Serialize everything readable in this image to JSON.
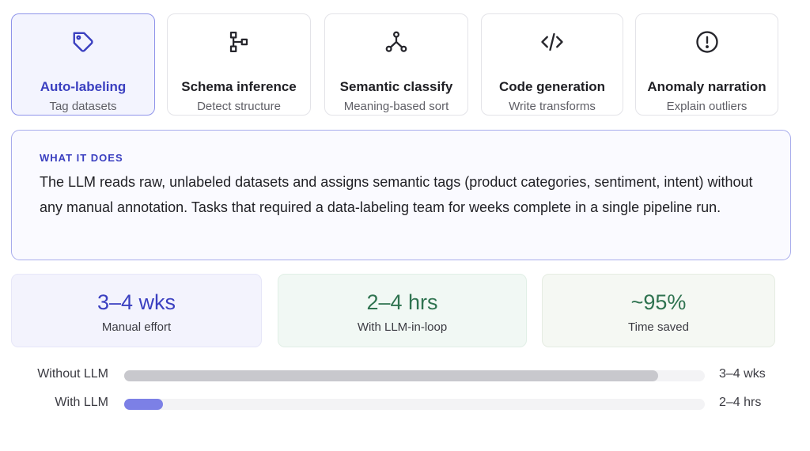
{
  "cards": [
    {
      "icon": "tag-icon",
      "title": "Auto-labeling",
      "subtitle": "Tag datasets",
      "active": true
    },
    {
      "icon": "hierarchy-icon",
      "title": "Schema inference",
      "subtitle": "Detect structure",
      "active": false
    },
    {
      "icon": "branch-icon",
      "title": "Semantic classify",
      "subtitle": "Meaning-based sort",
      "active": false
    },
    {
      "icon": "code-icon",
      "title": "Code generation",
      "subtitle": "Write transforms",
      "active": false
    },
    {
      "icon": "alert-circle-icon",
      "title": "Anomaly narration",
      "subtitle": "Explain outliers",
      "active": false
    }
  ],
  "what_it_does": {
    "label": "WHAT IT DOES",
    "description": "The LLM reads raw, unlabeled datasets and assigns semantic tags (product categories, sentiment, intent) without any manual annotation. Tasks that required a data-labeling team for weeks complete in a single pipeline run."
  },
  "metrics": [
    {
      "value": "3–4 wks",
      "label": "Manual effort",
      "color": "#3a3fc0",
      "bg": "#f3f3fd",
      "border": "#e6e6f8"
    },
    {
      "value": "2–4 hrs",
      "label": "With LLM-in-loop",
      "color": "#2f7350",
      "bg": "#f1f8f4",
      "border": "#e1efe6"
    },
    {
      "value": "~95%",
      "label": "Time saved",
      "color": "#2f7350",
      "bg": "#f5f8f3",
      "border": "#e5ece2"
    }
  ],
  "comparison": [
    {
      "label": "Without LLM",
      "value": "3–4 wks",
      "fill_fraction": 0.92,
      "color": "#c8c8cd"
    },
    {
      "label": "With LLM",
      "value": "2–4 hrs",
      "fill_fraction": 0.067,
      "color": "#7c80e6"
    }
  ],
  "colors": {
    "accent": "#3a3fc0",
    "accent_border": "#8f94ea",
    "icon": "#26262c"
  }
}
